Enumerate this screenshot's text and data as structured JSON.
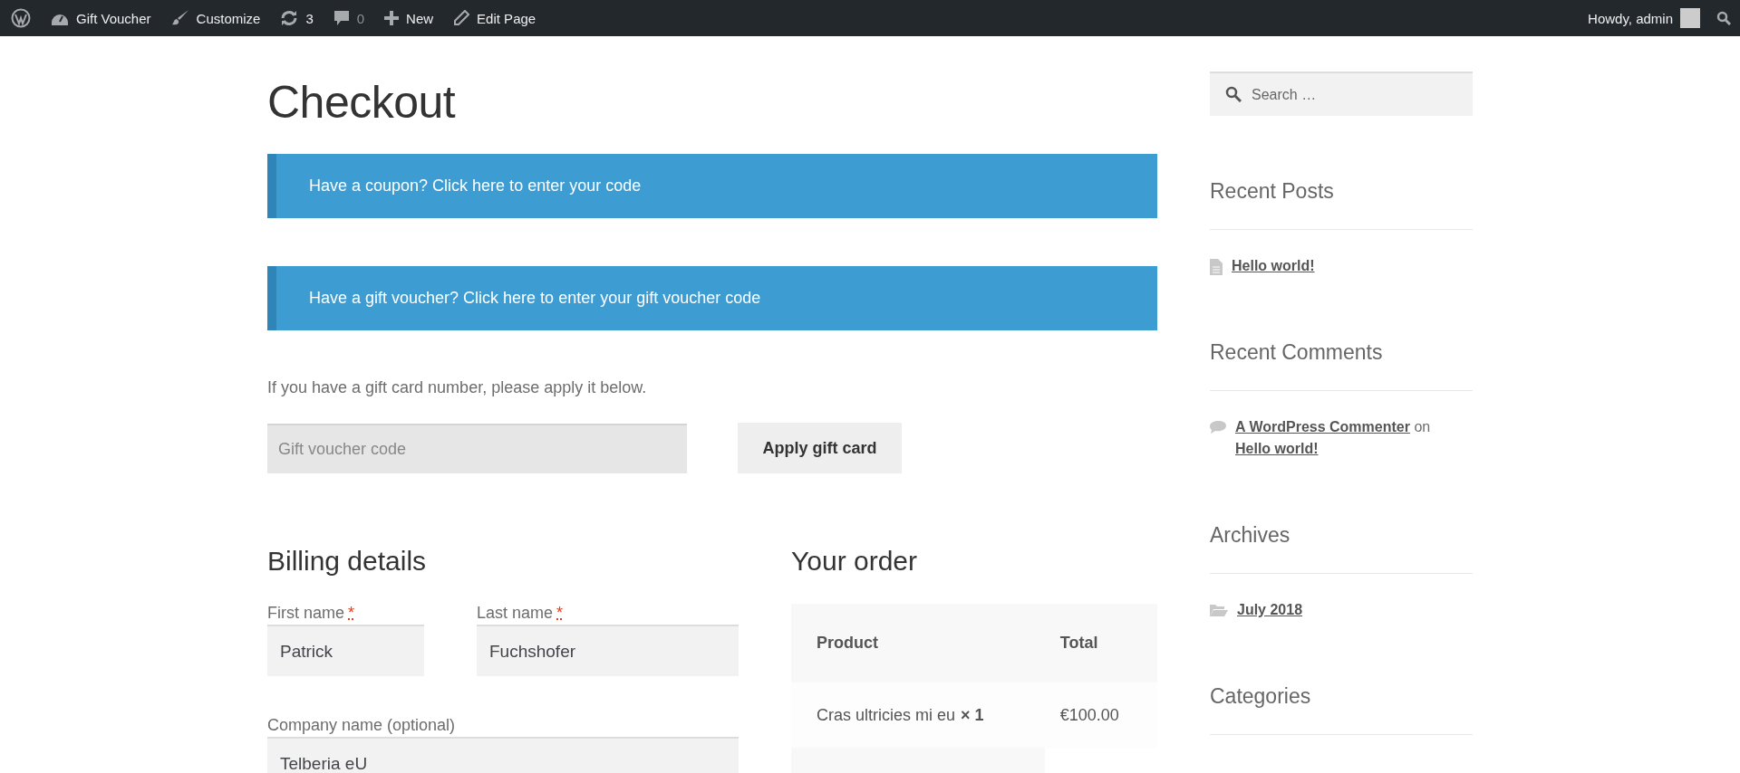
{
  "admin_bar": {
    "items": [
      {
        "kind": "logo"
      },
      {
        "kind": "site",
        "label": "Gift Voucher"
      },
      {
        "kind": "customize",
        "label": "Customize"
      },
      {
        "kind": "updates",
        "label": "3"
      },
      {
        "kind": "comments",
        "label": "0"
      },
      {
        "kind": "new",
        "label": "New"
      },
      {
        "kind": "edit",
        "label": "Edit Page"
      }
    ],
    "greeting": "Howdy, admin"
  },
  "page_title": "Checkout",
  "notices": [
    "Have a coupon? Click here to enter your code",
    "Have a gift voucher? Click here to enter your gift voucher code"
  ],
  "gift_card": {
    "intro": "If you have a gift card number, please apply it below.",
    "placeholder": "Gift voucher code",
    "button": "Apply gift card"
  },
  "billing": {
    "title": "Billing details",
    "required_mark": "*",
    "fields": [
      {
        "label": "First name",
        "required": true,
        "value": "Patrick"
      },
      {
        "label": "Last name",
        "required": true,
        "value": "Fuchshofer"
      },
      {
        "label": "Company name (optional)",
        "required": false,
        "value": "Telberia eU"
      }
    ]
  },
  "order": {
    "title": "Your order",
    "columns": [
      "Product",
      "Total"
    ],
    "rows": [
      {
        "product": "Cras ultricies mi eu",
        "quantity": "× 1",
        "total": "€100.00"
      }
    ]
  },
  "sidebar": {
    "search_placeholder": "Search …",
    "widgets": [
      {
        "title": "Recent Posts",
        "items": [
          {
            "kind": "post",
            "parts": [
              {
                "text": "Hello world!",
                "link": true
              }
            ]
          }
        ]
      },
      {
        "title": "Recent Comments",
        "items": [
          {
            "kind": "comment",
            "parts": [
              {
                "text": "A WordPress Commenter",
                "link": true
              },
              {
                "text": "on",
                "link": false
              },
              {
                "text": "Hello world!",
                "link": true
              }
            ]
          }
        ]
      },
      {
        "title": "Archives",
        "items": [
          {
            "kind": "archive",
            "parts": [
              {
                "text": "July 2018",
                "link": true
              }
            ]
          }
        ]
      },
      {
        "title": "Categories"
      }
    ]
  }
}
